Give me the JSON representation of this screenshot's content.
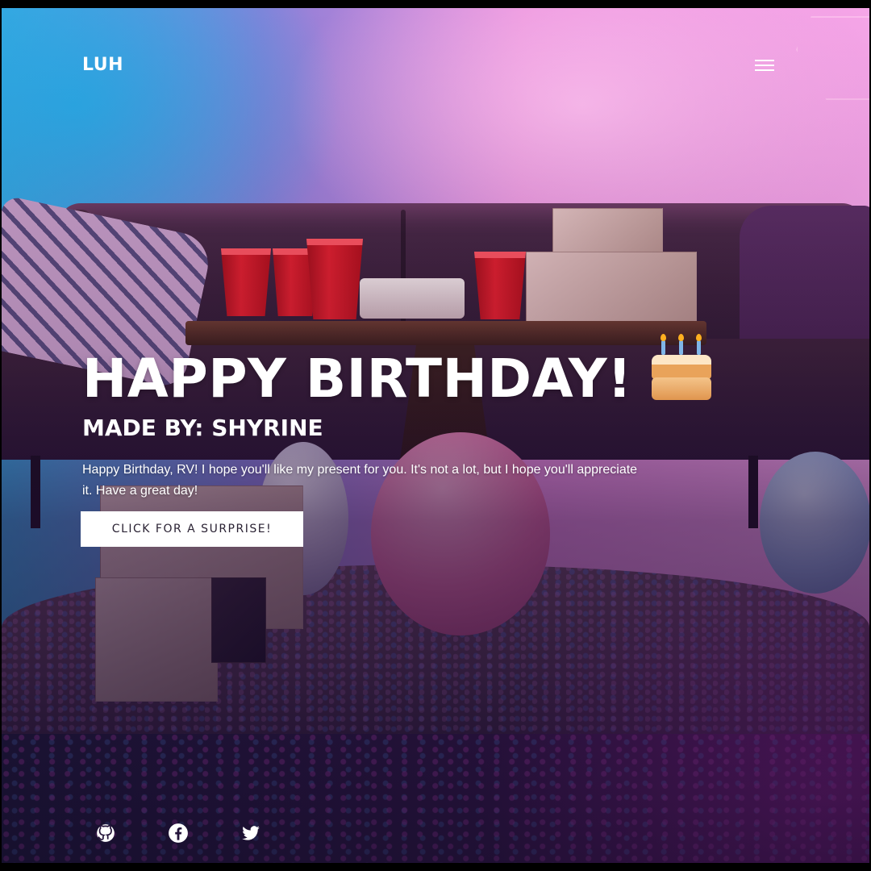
{
  "header": {
    "logo": "LUH",
    "menu_icon": "hamburger-menu-icon"
  },
  "hero": {
    "title": "HAPPY BIRTHDAY!",
    "title_icon": "birthday-cake-icon",
    "subtitle": "MADE BY: SHYRINE",
    "message": "Happy Birthday, RV! I hope you'll like my present for you. It's not a lot, but I hope you'll appreciate it. Have a great day!",
    "button_label": "CLICK FOR A SURPRISE!"
  },
  "footer": {
    "social_links": [
      {
        "icon": "github-icon"
      },
      {
        "icon": "facebook-icon"
      },
      {
        "icon": "twitter-icon"
      }
    ]
  },
  "colors": {
    "text": "#ffffff",
    "button_bg": "#ffffff",
    "button_text": "#2a2233"
  }
}
